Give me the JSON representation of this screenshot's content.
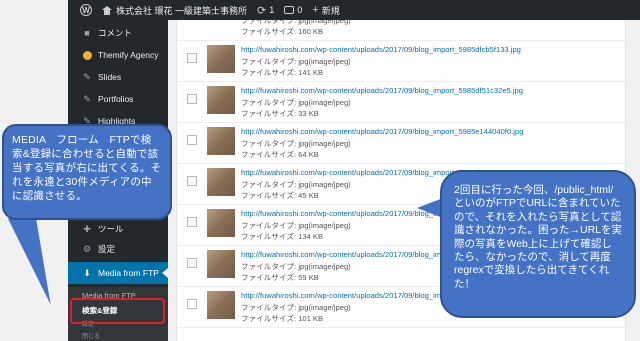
{
  "adminbar": {
    "site_name": "株式会社 環花 一級建築士事務所",
    "updates_count": "1",
    "comments_count": "0",
    "new_label": "新規"
  },
  "sidebar": {
    "items": [
      {
        "label": "コメント",
        "icon": "comment-icon"
      },
      {
        "label": "Themify Agency",
        "icon": "themify-icon"
      },
      {
        "label": "Slides",
        "icon": "pin-icon"
      },
      {
        "label": "Portfolios",
        "icon": "pin-icon"
      },
      {
        "label": "Highlights",
        "icon": "pin-icon"
      },
      {
        "label": "ツール",
        "icon": "wrench-icon"
      },
      {
        "label": "設定",
        "icon": "settings-icon"
      },
      {
        "label": "Media from FTP",
        "icon": "download-icon"
      }
    ],
    "submenu": [
      {
        "label": "Media from FTP"
      },
      {
        "label": "検索&登録"
      },
      {
        "label": "設定"
      },
      {
        "label": "閉じる"
      }
    ]
  },
  "files": [
    {
      "url": "",
      "type": "ファイルタイプ: jpg(image/jpeg)",
      "size": "ファイルサイズ: 160 KB"
    },
    {
      "url": "http://fuwahiroshi.com/wp-content/uploads/2017/09/blog_import_5985dfcb5f133.jpg",
      "type": "ファイルタイプ: jpg(image/jpeg)",
      "size": "ファイルサイズ: 141 KB"
    },
    {
      "url": "http://fuwahiroshi.com/wp-content/uploads/2017/09/blog_import_5985df51c32e5.jpg",
      "type": "ファイルタイプ: jpg(image/jpeg)",
      "size": "ファイルサイズ: 33 KB"
    },
    {
      "url": "http://fuwahiroshi.com/wp-content/uploads/2017/09/blog_import_5985e144040f0.jpg",
      "type": "ファイルタイプ: jpg(image/jpeg)",
      "size": "ファイルサイズ: 64 KB"
    },
    {
      "url": "http://fuwahiroshi.com/wp-content/uploads/2017/09/blog_import_5985d",
      "type": "ファイルタイプ: jpg(image/jpeg)",
      "size": "ファイルサイズ: 45 KB"
    },
    {
      "url": "http://fuwahiroshi.com/wp-content/uploads/2017/09/blog_import_59",
      "type": "ファイルタイプ: jpg(image/jpeg)",
      "size": "ファイルサイズ: 134 KB"
    },
    {
      "url": "http://fuwahiroshi.com/wp-content/uploads/2017/09/blog_import_59",
      "type": "ファイルタイプ: jpg(image/jpeg)",
      "size": "ファイルサイズ: 59 KB"
    },
    {
      "url": "http://fuwahiroshi.com/wp-content/uploads/2017/09/blog_import_5985e0df70c60.jpg",
      "type": "ファイルタイプ: jpg(image/jpeg)",
      "size": "ファイルサイズ: 101 KB"
    }
  ],
  "callouts": {
    "left": "MEDIA　フローム　FTPで検索&登録に合わせると自動で該当する写真が右に出てくる。それを永遠と30件メディアの中に認識させる。",
    "right": "2回目に行った今回、/public_html/といのがFTPでURLに含まれていたので、それを入れたら写真として認識されなかった。困った→URLを実際の写真をWeb上に上げて確認したら、なかったので、消して再度regrexで変換したら出てきてくれた！"
  }
}
